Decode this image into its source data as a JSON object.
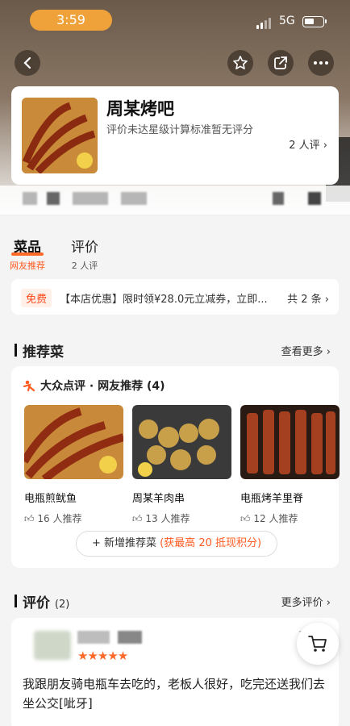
{
  "status": {
    "time": "3:59",
    "network": "5G"
  },
  "shop": {
    "name": "周某烤吧",
    "subtitle": "评价未达星级计算标准暂无评分",
    "review_count": "2 人评 ›"
  },
  "tabs": [
    {
      "label": "菜品",
      "sub": "网友推荐"
    },
    {
      "label": "评价",
      "sub": "2 人评"
    }
  ],
  "coupon": {
    "tag": "免费",
    "text": "【本店优惠】限时领¥28.0元立减券，立即...",
    "count": "共 2 条 ›"
  },
  "recommend": {
    "title": "推荐菜",
    "more": "查看更多 ›",
    "source": "大众点评 · 网友推荐 (4)",
    "dishes": [
      {
        "name": "电瓶煎鱿鱼",
        "likes": "16 人推荐"
      },
      {
        "name": "周某羊肉串",
        "likes": "13 人推荐"
      },
      {
        "name": "电瓶烤羊里脊",
        "likes": "12 人推荐"
      }
    ],
    "add_label": "+ 新增推荐菜",
    "add_bonus": "(获最高 20 抵现积分)"
  },
  "reviews": {
    "title": "评价",
    "count": "(2)",
    "more": "更多评价 ›",
    "first": {
      "stars": "★★★★★",
      "date": "2/",
      "text": "我跟朋友骑电瓶车去吃的，老板人很好，吃完还送我们去坐公交[呲牙]"
    }
  },
  "colors": {
    "accent": "#ff5a1f",
    "time_pill": "#f0a23a"
  }
}
